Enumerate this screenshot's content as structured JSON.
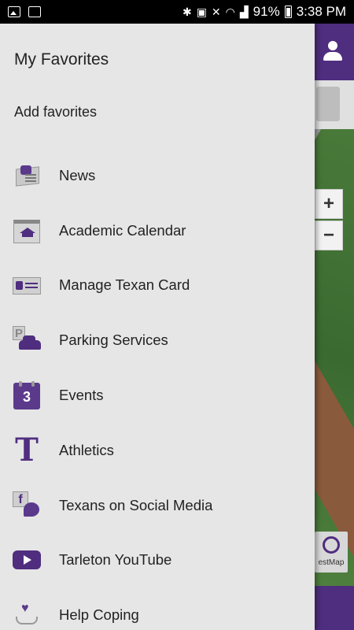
{
  "status_bar": {
    "left_icons": [
      "image-icon",
      "exchange-icon"
    ],
    "right_icons": [
      "bluetooth-icon",
      "nfc-icon",
      "vibrate-icon",
      "wifi-icon",
      "signal-icon"
    ],
    "battery": "91%",
    "time": "3:38 PM"
  },
  "background": {
    "zoom_in": "+",
    "zoom_out": "−",
    "gather_label": "estMap"
  },
  "drawer": {
    "title": "My Favorites",
    "add_favorites": "Add favorites",
    "items": [
      {
        "label": "News",
        "icon": "news-icon"
      },
      {
        "label": "Academic Calendar",
        "icon": "calendar-icon"
      },
      {
        "label": "Manage Texan Card",
        "icon": "id-card-icon"
      },
      {
        "label": "Parking Services",
        "icon": "parking-icon"
      },
      {
        "label": "Events",
        "icon": "events-icon",
        "day": "3"
      },
      {
        "label": "Athletics",
        "icon": "athletics-icon",
        "glyph": "T"
      },
      {
        "label": "Texans on Social Media",
        "icon": "social-media-icon",
        "glyph": "f"
      },
      {
        "label": "Tarleton YouTube",
        "icon": "youtube-icon"
      },
      {
        "label": "Help Coping",
        "icon": "help-coping-icon"
      }
    ]
  },
  "colors": {
    "brand_purple": "#4f2d7f",
    "drawer_bg": "#e6e6e6"
  }
}
